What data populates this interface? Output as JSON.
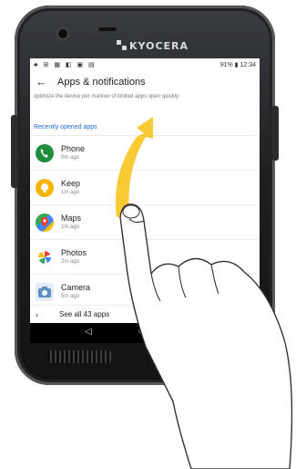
{
  "brand": "KYOCERA",
  "status": {
    "left_icons": "♣ ⊞ ▦ ◧ ▣ ▤",
    "right": "91% ▮ 12:34"
  },
  "header": {
    "back_icon": "back-arrow-icon",
    "title": "Apps & notifications"
  },
  "blurb": "optimize the device per manner of limited apps open quickly",
  "section_title": "Recently opened apps",
  "apps": [
    {
      "name": "Phone",
      "time": "0m ago",
      "color": "#1e8e3e"
    },
    {
      "name": "Keep",
      "time": "1m ago",
      "color": "#f6b400"
    },
    {
      "name": "Maps",
      "time": "1m ago",
      "color": "#4285f4"
    },
    {
      "name": "Photos",
      "time": "2m ago",
      "color": "#ea4335"
    },
    {
      "name": "Camera",
      "time": "5m ago",
      "color": "#5f8fbf"
    }
  ],
  "see_all": "See all 43 apps",
  "colors": {
    "accent": "#1e6bd6",
    "swipe_arrow": "#f7c623"
  }
}
